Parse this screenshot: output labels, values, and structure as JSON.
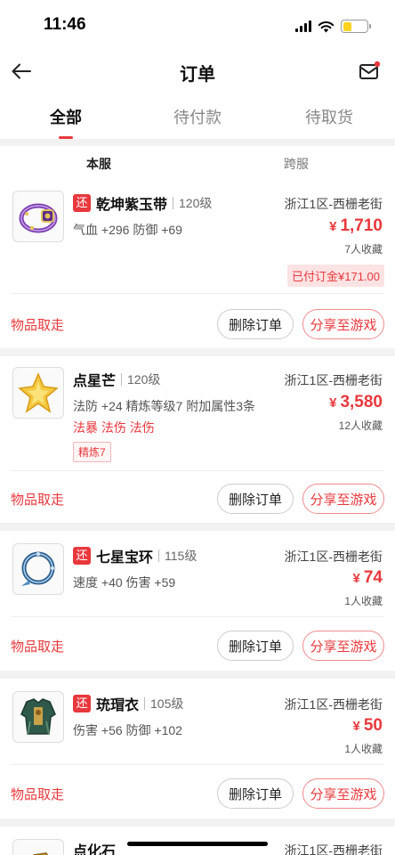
{
  "status_bar": {
    "time": "11:46"
  },
  "nav": {
    "title": "订单"
  },
  "tabs": [
    {
      "label": "全部",
      "active": true
    },
    {
      "label": "待付款",
      "active": false
    },
    {
      "label": "待取货",
      "active": false
    }
  ],
  "server_tabs": {
    "own": "本服",
    "cross": "跨服"
  },
  "orders": [
    {
      "return_tag": "还",
      "name": "乾坤紫玉带",
      "level": "120级",
      "attrs": "气血 +296  防御 +69",
      "server": "浙江1区-西栅老街",
      "price_currency": "¥",
      "price": "1,710",
      "favorites": "7人收藏",
      "deposit": "已付订金¥171.00",
      "status": "物品取走",
      "delete_label": "删除订单",
      "share_label": "分享至游戏"
    },
    {
      "name": "点星芒",
      "level": "120级",
      "attrs": "法防 +24  精炼等级7  附加属性3条",
      "special": "法暴  法伤  法伤",
      "refine": "精炼7",
      "server": "浙江1区-西栅老街",
      "price_currency": "¥",
      "price": "3,580",
      "favorites": "12人收藏",
      "status": "物品取走",
      "delete_label": "删除订单",
      "share_label": "分享至游戏"
    },
    {
      "return_tag": "还",
      "name": "七星宝环",
      "level": "115级",
      "attrs": "速度 +40  伤害 +59",
      "server": "浙江1区-西栅老街",
      "price_currency": "¥",
      "price": "74",
      "favorites": "1人收藏",
      "status": "物品取走",
      "delete_label": "删除订单",
      "share_label": "分享至游戏"
    },
    {
      "return_tag": "还",
      "name": "珫瑁衣",
      "level": "105级",
      "attrs": "伤害 +56  防御 +102",
      "server": "浙江1区-西栅老街",
      "price_currency": "¥",
      "price": "50",
      "favorites": "1人收藏",
      "status": "物品取走",
      "delete_label": "删除订单",
      "share_label": "分享至游戏"
    },
    {
      "name": "点化石",
      "server": "浙江1区-西栅老街"
    }
  ],
  "colors": {
    "accent": "#e8383d",
    "battery": "#ffd21e"
  }
}
